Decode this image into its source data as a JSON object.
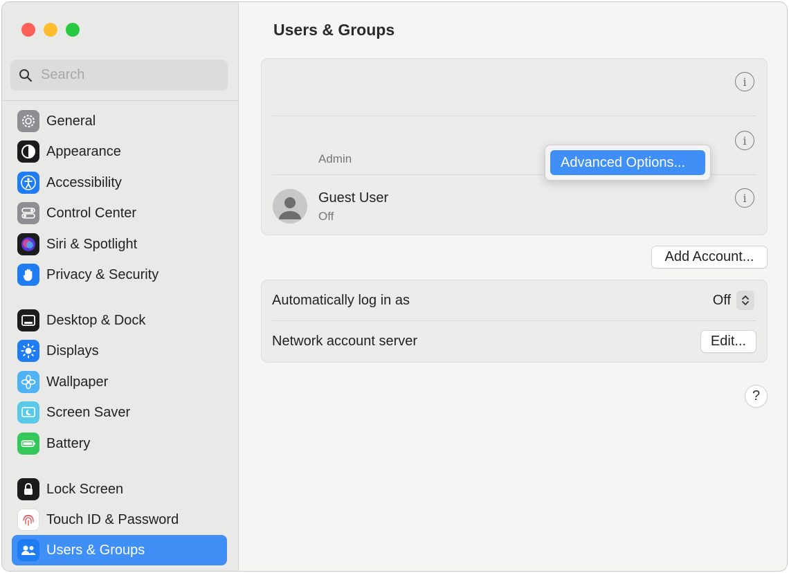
{
  "window": {
    "title": "Users & Groups"
  },
  "search": {
    "placeholder": "Search"
  },
  "sidebar": {
    "items": [
      {
        "label": "General",
        "icon": "gear-icon",
        "color": "#8e8e93"
      },
      {
        "label": "Appearance",
        "icon": "appearance-icon",
        "color": "#1c1c1e"
      },
      {
        "label": "Accessibility",
        "icon": "accessibility-icon",
        "color": "#1f7cf2"
      },
      {
        "label": "Control Center",
        "icon": "control-center-icon",
        "color": "#8e8e93"
      },
      {
        "label": "Siri & Spotlight",
        "icon": "siri-icon",
        "color": "#1c1c1e"
      },
      {
        "label": "Privacy & Security",
        "icon": "hand-icon",
        "color": "#1f7cf2"
      },
      {
        "label": "Desktop & Dock",
        "icon": "dock-icon",
        "color": "#1c1c1e"
      },
      {
        "label": "Displays",
        "icon": "sun-icon",
        "color": "#1f7cf2"
      },
      {
        "label": "Wallpaper",
        "icon": "flower-icon",
        "color": "#4fb3f5"
      },
      {
        "label": "Screen Saver",
        "icon": "screen-saver-icon",
        "color": "#5ac8e8"
      },
      {
        "label": "Battery",
        "icon": "battery-icon",
        "color": "#34c759"
      },
      {
        "label": "Lock Screen",
        "icon": "lock-icon",
        "color": "#1c1c1e"
      },
      {
        "label": "Touch ID & Password",
        "icon": "fingerprint-icon",
        "color": "#ffffff"
      },
      {
        "label": "Users & Groups",
        "icon": "users-icon",
        "color": "#1f7cf2"
      }
    ],
    "active": "Users & Groups"
  },
  "users": {
    "admin_label": "Admin",
    "guest_name": "Guest User",
    "guest_status": "Off",
    "info_glyph": "i"
  },
  "context_menu": {
    "item": "Advanced Options..."
  },
  "buttons": {
    "add_account": "Add Account...",
    "edit": "Edit...",
    "help": "?"
  },
  "settings": {
    "auto_login_label": "Automatically log in as",
    "auto_login_value": "Off",
    "network_server_label": "Network account server"
  },
  "colors": {
    "accent": "#3f8ff7"
  }
}
